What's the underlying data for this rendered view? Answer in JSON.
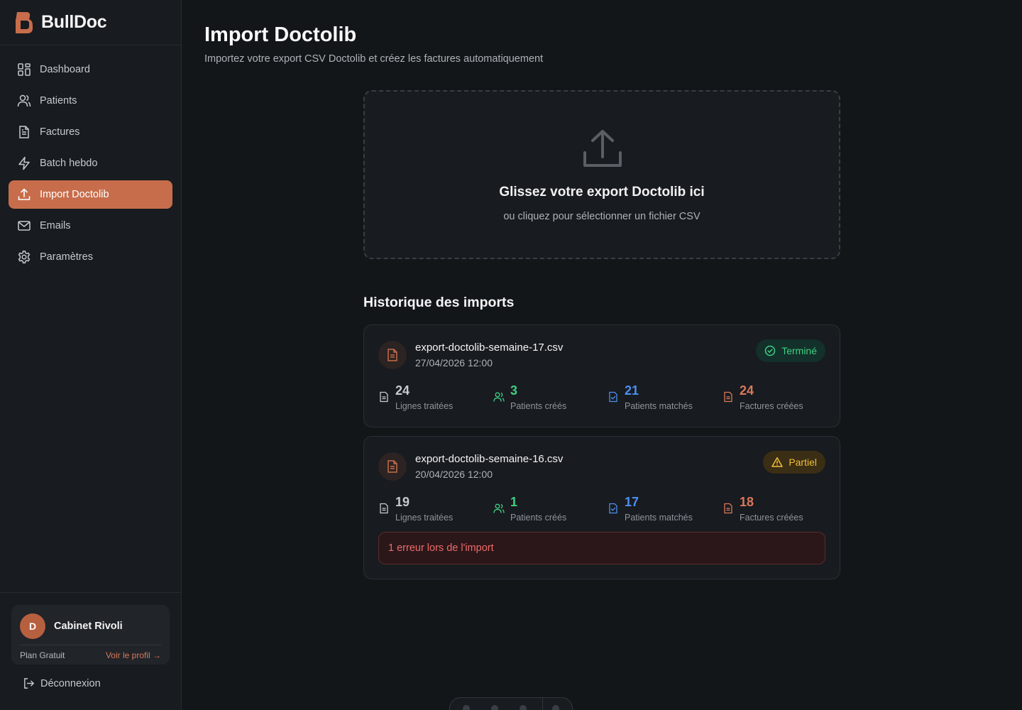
{
  "brand": {
    "name": "BullDoc"
  },
  "sidebar": {
    "items": [
      {
        "label": "Dashboard",
        "icon": "dashboard-icon"
      },
      {
        "label": "Patients",
        "icon": "users-icon"
      },
      {
        "label": "Factures",
        "icon": "document-icon"
      },
      {
        "label": "Batch hebdo",
        "icon": "lightning-icon"
      },
      {
        "label": "Import Doctolib",
        "icon": "upload-icon",
        "active": true
      },
      {
        "label": "Emails",
        "icon": "mail-icon"
      },
      {
        "label": "Paramètres",
        "icon": "gear-icon"
      }
    ],
    "profile": {
      "initial": "D",
      "name": "Cabinet Rivoli",
      "plan": "Plan Gratuit",
      "link": "Voir le profil →"
    },
    "logout": "Déconnexion"
  },
  "main": {
    "title": "Import Doctolib",
    "subtitle": "Importez votre export CSV Doctolib et créez les factures automatiquement",
    "dropzone": {
      "title": "Glissez votre export Doctolib ici",
      "subtitle": "ou cliquez pour sélectionner un fichier CSV"
    },
    "history_title": "Historique des imports",
    "imports": [
      {
        "file": "export-doctolib-semaine-17.csv",
        "date": "27/04/2026 12:00",
        "status": "Terminé",
        "stats": [
          {
            "value": "24",
            "label": "Lignes traitées"
          },
          {
            "value": "3",
            "label": "Patients créés"
          },
          {
            "value": "21",
            "label": "Patients matchés"
          },
          {
            "value": "24",
            "label": "Factures créées"
          }
        ]
      },
      {
        "file": "export-doctolib-semaine-16.csv",
        "date": "20/04/2026 12:00",
        "status": "Partiel",
        "stats": [
          {
            "value": "19",
            "label": "Lignes traitées"
          },
          {
            "value": "1",
            "label": "Patients créés"
          },
          {
            "value": "17",
            "label": "Patients matchés"
          },
          {
            "value": "18",
            "label": "Factures créées"
          }
        ],
        "error": "1 erreur lors de l'import"
      }
    ]
  },
  "colors": {
    "accent": "#c76d4b",
    "success": "#3fcf83",
    "warning": "#f2bd3c",
    "info": "#4d8ff0",
    "error": "#f06a6a"
  }
}
